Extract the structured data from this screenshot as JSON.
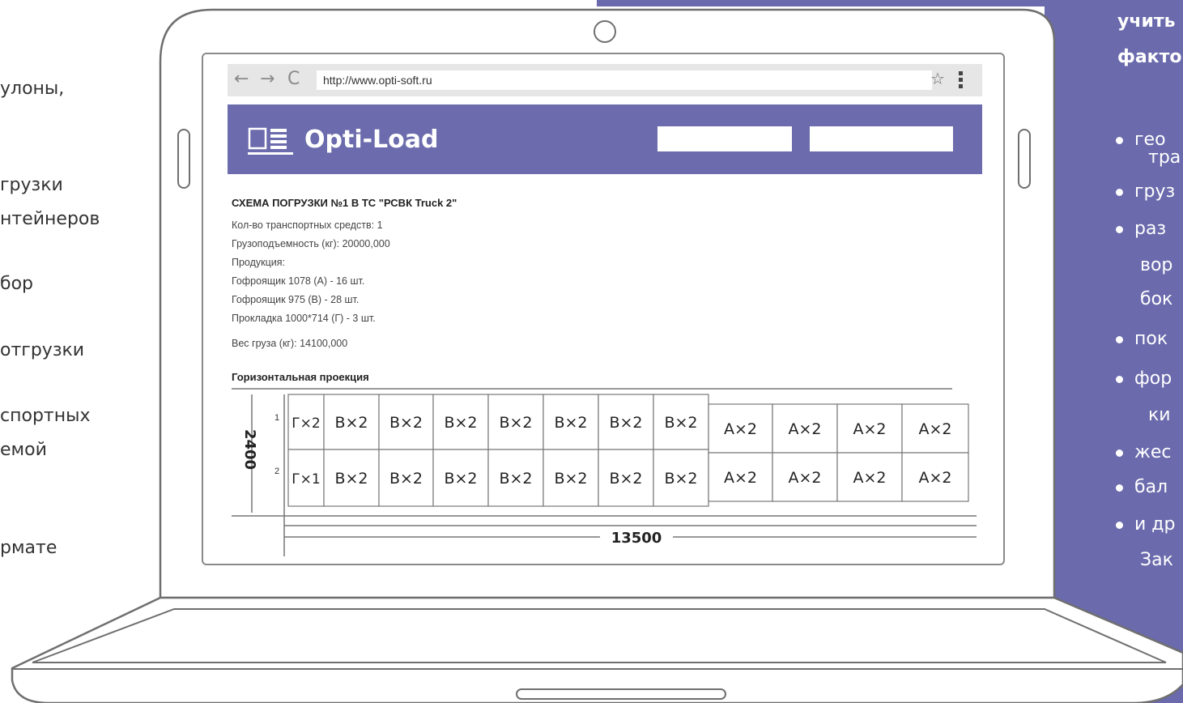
{
  "left_column": {
    "lines": [
      "улоны,",
      "грузки",
      "нтейнеров",
      "бор",
      "отгрузки",
      "спортных",
      "емой",
      "рмате"
    ]
  },
  "right_panel": {
    "heading": [
      "учить",
      "факто"
    ],
    "items": [
      {
        "label": "гео",
        "cont": "тра"
      },
      {
        "label": "груз",
        "cont": ""
      },
      {
        "label": "раз",
        "cont": "вор"
      },
      {
        "label": "",
        "cont": "бок"
      },
      {
        "label": "пок",
        "cont": ""
      },
      {
        "label": "фор",
        "cont": "ки"
      },
      {
        "label": "жес",
        "cont": ""
      },
      {
        "label": "бал",
        "cont": ""
      },
      {
        "label": "и др",
        "cont": "Зак"
      }
    ]
  },
  "browser": {
    "back": "←",
    "forward": "→",
    "reload": "C",
    "url": "http://www.opti-soft.ru",
    "star": "☆"
  },
  "app": {
    "title": "Opti-Load"
  },
  "document": {
    "title": "СХЕМА ПОГРУЗКИ №1 В ТС \"РСВК Truck 2\"",
    "lines": [
      "Кол-во транспортных средств: 1",
      "Грузоподъемность (кг): 20000,000",
      "Продукция:",
      "Гофроящик 1078 (А) - 16 шт.",
      "Гофроящик 975 (В) - 28 шт.",
      "Прокладка 1000*714 (Г) - 3 шт.",
      "Вес груза (кг): 14100,000"
    ],
    "projection_title": "Горизонтальная проекция"
  },
  "diagram": {
    "width_label": "2400",
    "length_label": "13500",
    "rows": [
      {
        "num": "1",
        "cells": [
          "Г×2",
          "В×2",
          "В×2",
          "В×2",
          "В×2",
          "В×2",
          "В×2",
          "В×2",
          "А×2",
          "А×2",
          "А×2",
          "А×2"
        ]
      },
      {
        "num": "2",
        "cells": [
          "Г×1",
          "В×2",
          "В×2",
          "В×2",
          "В×2",
          "В×2",
          "В×2",
          "В×2",
          "А×2",
          "А×2",
          "А×2",
          "А×2"
        ]
      }
    ]
  }
}
